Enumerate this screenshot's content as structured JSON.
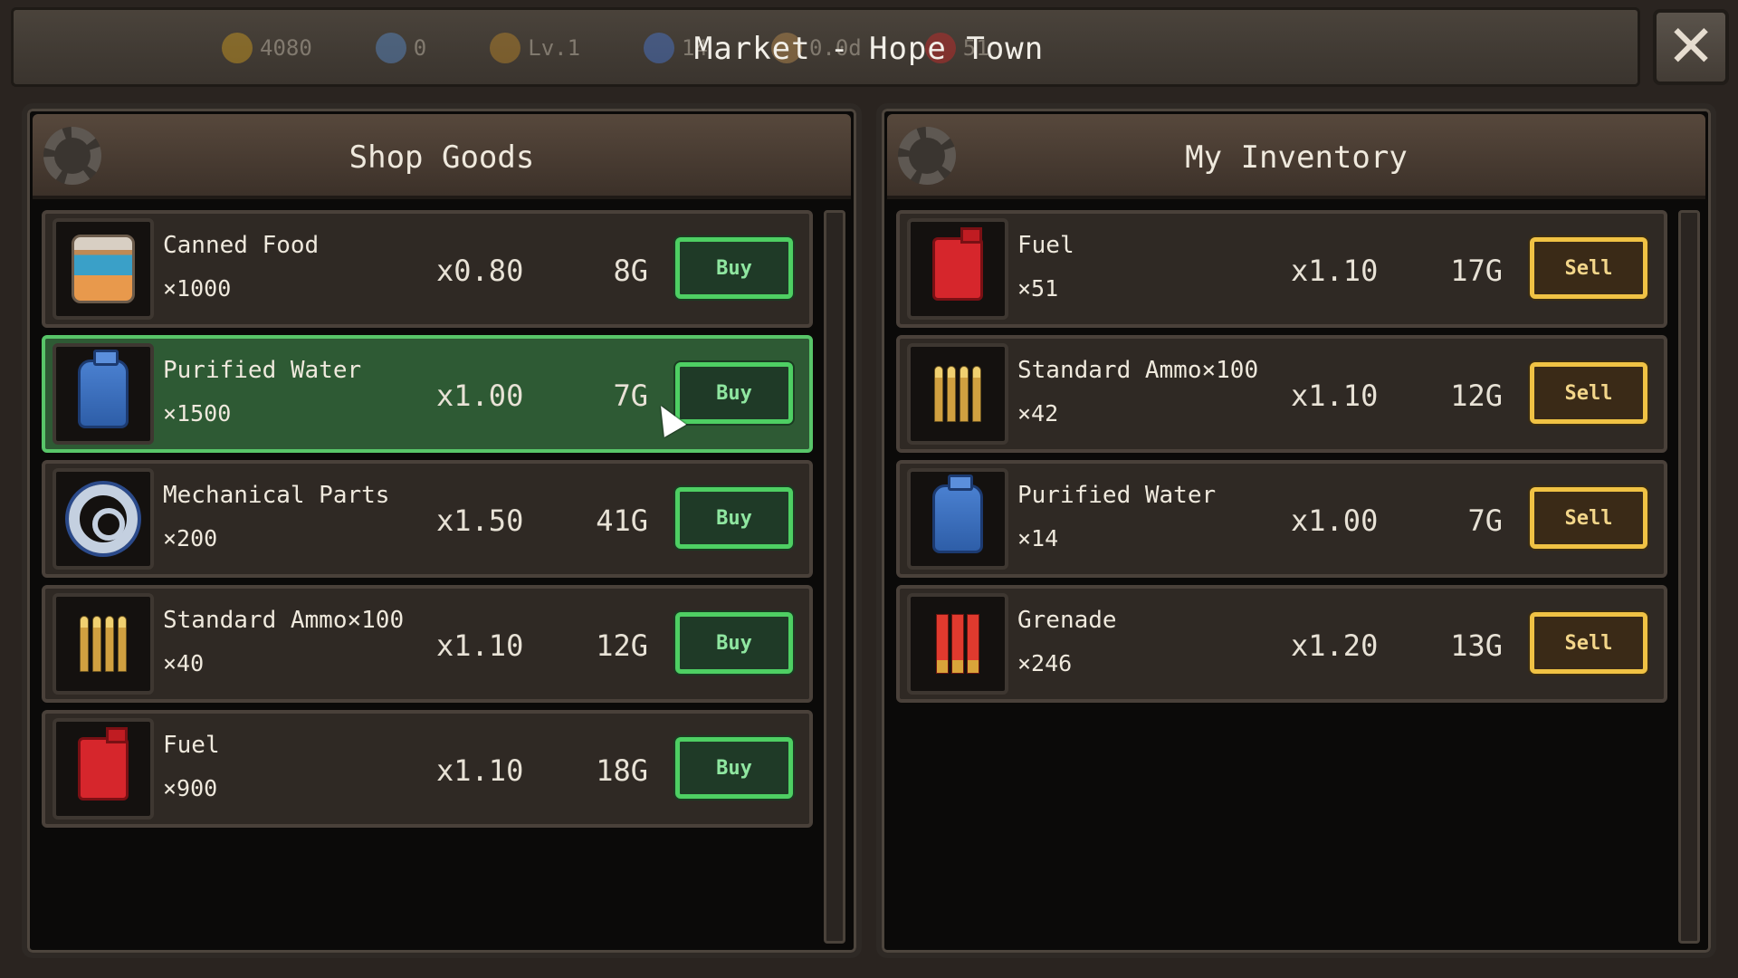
{
  "window": {
    "title": "Market - Hope Town",
    "close_label": "✕"
  },
  "top_stats": [
    {
      "icon": "coin-icon",
      "value": "4080",
      "color": "#d4a020"
    },
    {
      "icon": "crystal-icon",
      "value": "0",
      "color": "#5a8ed0"
    },
    {
      "icon": "badge-icon",
      "value": "Lv.1",
      "color": "#c08a2a"
    },
    {
      "icon": "arrow-up-icon",
      "value": "14",
      "color": "#4a7ad8"
    },
    {
      "icon": "crate-icon",
      "value": "0.0d",
      "color": "#c09050"
    },
    {
      "icon": "fuel-icon",
      "value": "51",
      "color": "#d02a2a"
    }
  ],
  "shop": {
    "title": "Shop Goods",
    "items": [
      {
        "icon": "canned-food-icon",
        "name": "Canned Food",
        "qty": "×1000",
        "multiplier": "x0.80",
        "price": "8G",
        "action": "Buy",
        "selected": false
      },
      {
        "icon": "purified-water-icon",
        "name": "Purified Water",
        "qty": "×1500",
        "multiplier": "x1.00",
        "price": "7G",
        "action": "Buy",
        "selected": true
      },
      {
        "icon": "mechanical-parts-icon",
        "name": "Mechanical Parts",
        "qty": "×200",
        "multiplier": "x1.50",
        "price": "41G",
        "action": "Buy",
        "selected": false
      },
      {
        "icon": "ammo-icon",
        "name": "Standard Ammo×100",
        "qty": "×40",
        "multiplier": "x1.10",
        "price": "12G",
        "action": "Buy",
        "selected": false
      },
      {
        "icon": "fuel-can-icon",
        "name": "Fuel",
        "qty": "×900",
        "multiplier": "x1.10",
        "price": "18G",
        "action": "Buy",
        "selected": false
      }
    ]
  },
  "inventory": {
    "title": "My Inventory",
    "items": [
      {
        "icon": "fuel-can-icon",
        "name": "Fuel",
        "qty": "×51",
        "multiplier": "x1.10",
        "price": "17G",
        "action": "Sell"
      },
      {
        "icon": "ammo-icon",
        "name": "Standard Ammo×100",
        "qty": "×42",
        "multiplier": "x1.10",
        "price": "12G",
        "action": "Sell"
      },
      {
        "icon": "purified-water-icon",
        "name": "Purified Water",
        "qty": "×14",
        "multiplier": "x1.00",
        "price": "7G",
        "action": "Sell"
      },
      {
        "icon": "grenade-icon",
        "name": "Grenade",
        "qty": "×246",
        "multiplier": "x1.20",
        "price": "13G",
        "action": "Sell"
      }
    ]
  },
  "colors": {
    "buy_accent": "#4ecf63",
    "sell_accent": "#f0c244",
    "selected_row": "#2e5a34"
  }
}
